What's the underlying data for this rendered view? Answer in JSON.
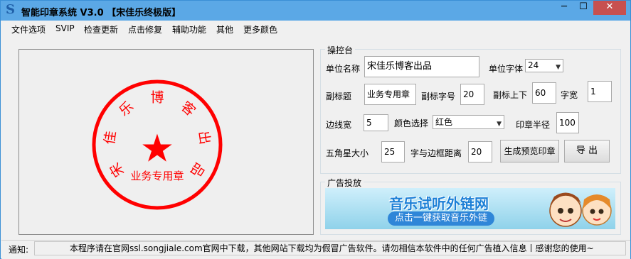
{
  "window": {
    "title": "智能印章系统 V3.0 【宋佳乐终极版】",
    "app_icon": "S",
    "min_glyph": "─",
    "max_glyph": "☐",
    "close_glyph": "✕"
  },
  "menu": [
    "文件选项",
    "SVIP",
    "检查更新",
    "点击修复",
    "辅助功能",
    "其他",
    "更多颜色"
  ],
  "preview": {
    "arc_chars": [
      "宋",
      "佳",
      "乐",
      "博",
      "客",
      "出",
      "品"
    ],
    "star": "★",
    "subtitle": "业务专用章",
    "color": "#ff0000"
  },
  "controls": {
    "group_title": "操控台",
    "unit_name_label": "单位名称",
    "unit_name_value": "宋佳乐博客出品",
    "unit_font_label": "单位字体",
    "unit_font_value": "24",
    "subtitle_label": "副标题",
    "subtitle_value": "业务专用章",
    "subtitle_size_label": "副标字号",
    "subtitle_size_value": "20",
    "subtitle_offset_label": "副标上下",
    "subtitle_offset_value": "60",
    "char_width_label": "字宽",
    "char_width_value": "1",
    "border_width_label": "边线宽",
    "border_width_value": "5",
    "color_label": "颜色选择",
    "color_value": "红色",
    "radius_label": "印章半径",
    "radius_value": "100",
    "star_size_label": "五角星大小",
    "star_size_value": "25",
    "text_gap_label": "字与边框距离",
    "text_gap_value": "20",
    "generate_button": "生成预览印章",
    "export_button": "导  出"
  },
  "ads": {
    "group_title": "广告投放",
    "headline": "音乐试听外链网",
    "cta": "点击一键获取音乐外链"
  },
  "status": {
    "label": "通知:",
    "text": "本程序请在官网ssl.songjiale.com官网中下载，其他网站下载均为假冒广告软件。请勿相信本软件中的任何广告植入信息丨感谢您的使用~"
  }
}
